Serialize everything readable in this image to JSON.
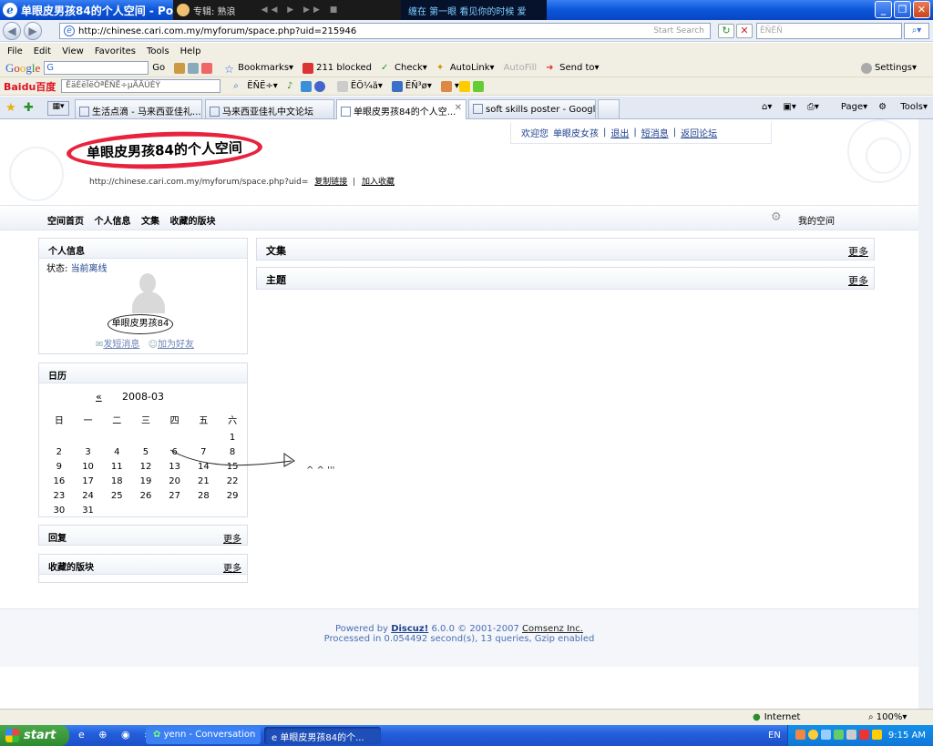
{
  "window": {
    "title": "单眼皮男孩84的个人空间 - Pow",
    "media_text": "专辑: 熟浪",
    "ticker_text": "缠在  第一眼 看见你的时候  爱"
  },
  "address": {
    "url": "http://chinese.cari.com.my/myforum/space.php?uid=215946",
    "search_hint": "Start Search",
    "search_box": "ËÑËÑ"
  },
  "menu": [
    "File",
    "Edit",
    "View",
    "Favorites",
    "Tools",
    "Help"
  ],
  "toolbar1": {
    "google_box": "G",
    "go": "Go",
    "bookmarks": "Bookmarks",
    "blocked": "211 blocked",
    "check": "Check",
    "autolink": "AutoLink",
    "autofill": "AutoFill",
    "sendto": "Send to",
    "settings": "Settings"
  },
  "toolbar2": {
    "baidu": "Baidu百度",
    "baidu_box": "ÊäÈëÏëÒªËÑË÷µÄÄÚÈÝ",
    "search": "ËÑË÷",
    "item2": "ËÖ¼ä",
    "item3": "ËÑ³ø"
  },
  "tabs": [
    {
      "label": "生活点滴 - 马来西亚佳礼..."
    },
    {
      "label": "马来西亚佳礼中文论坛"
    },
    {
      "label": "单眼皮男孩84的个人空..."
    },
    {
      "label": "soft skills poster - Google Im..."
    }
  ],
  "commandbar": {
    "page": "Page",
    "tools": "Tools"
  },
  "userbar": {
    "welcome": "欢迎您",
    "user": "单眼皮女孩",
    "logout": "退出",
    "messages": "短消息",
    "back": "返回论坛"
  },
  "space": {
    "title": "单眼皮男孩84的个人空间",
    "url": "http://chinese.cari.com.my/myforum/space.php?uid=",
    "copy_link": "复制链接",
    "add_fav": "加入收藏"
  },
  "nav": {
    "links": [
      "空间首页",
      "个人信息",
      "文集",
      "收藏的版块"
    ],
    "my_space": "我的空间"
  },
  "profile": {
    "heading": "个人信息",
    "status_label": "状态:",
    "status_value": "当前离线",
    "username": "单眼皮男孩84",
    "send_msg": "发短消息",
    "add_friend": "加为好友"
  },
  "calendar": {
    "heading": "日历",
    "prev": "«",
    "month": "2008-03",
    "weekdays": [
      "日",
      "一",
      "二",
      "三",
      "四",
      "五",
      "六"
    ],
    "rows": [
      [
        "",
        "",
        "",
        "",
        "",
        "",
        "1"
      ],
      [
        "2",
        "3",
        "4",
        "5",
        "6",
        "7",
        "8"
      ],
      [
        "9",
        "10",
        "11",
        "12",
        "13",
        "14",
        "15"
      ],
      [
        "16",
        "17",
        "18",
        "19",
        "20",
        "21",
        "22"
      ],
      [
        "23",
        "24",
        "25",
        "26",
        "27",
        "28",
        "29"
      ],
      [
        "30",
        "31",
        "",
        "",
        "",
        "",
        ""
      ]
    ]
  },
  "replies": {
    "heading": "回复",
    "more": "更多"
  },
  "favorites": {
    "heading": "收藏的版块",
    "more": "更多"
  },
  "articles": {
    "heading": "文集",
    "more": "更多"
  },
  "topics": {
    "heading": "主题",
    "more": "更多"
  },
  "scribble": "^ ^ '''",
  "footer": {
    "powered": "Powered by",
    "discuz": "Discuz!",
    "version": "6.0.0",
    "copy": "© 2001-2007",
    "comsenz": "Comsenz Inc.",
    "processed": "Processed in 0.054492 second(s), 13 queries, Gzip enabled"
  },
  "statusbar": {
    "zone": "Internet",
    "zoom": "100%"
  },
  "taskbar": {
    "start": "start",
    "task1": "yenn - Conversation",
    "task2": "单眼皮男孩84的个...",
    "lang": "EN",
    "clock": "9:15 AM"
  }
}
